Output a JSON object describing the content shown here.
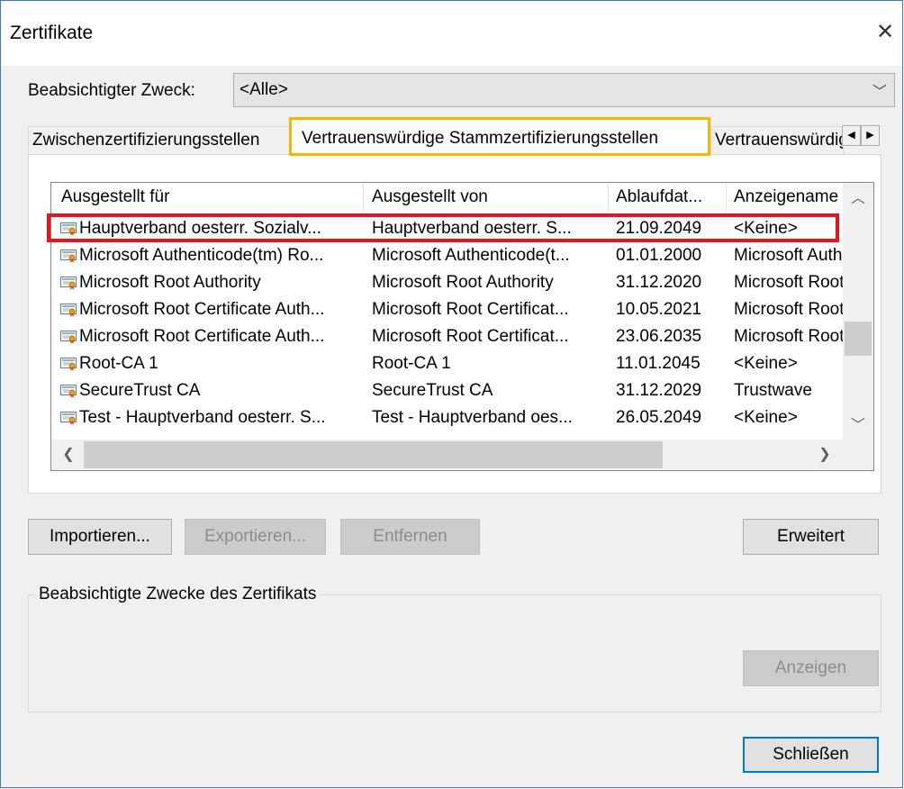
{
  "window": {
    "title": "Zertifikate"
  },
  "purpose": {
    "label": "Beabsichtigter Zweck:",
    "selected": "<Alle>"
  },
  "tabs": [
    {
      "label": "Zwischenzertifizierungsstellen"
    },
    {
      "label": "Vertrauenswürdige Stammzertifizierungsstellen"
    },
    {
      "label": "Vertrauenswürdige Herausgeber"
    }
  ],
  "table": {
    "columns": [
      "Ausgestellt für",
      "Ausgestellt von",
      "Ablaufdat...",
      "Anzeigename"
    ],
    "rows": [
      [
        "Hauptverband oesterr. Sozialv...",
        "Hauptverband oesterr. S...",
        "21.09.2049",
        "<Keine>"
      ],
      [
        "Microsoft Authenticode(tm) Ro...",
        "Microsoft Authenticode(t...",
        "01.01.2000",
        "Microsoft Authenticode"
      ],
      [
        "Microsoft Root Authority",
        "Microsoft Root Authority",
        "31.12.2020",
        "Microsoft Root"
      ],
      [
        "Microsoft Root Certificate Auth...",
        "Microsoft Root Certificat...",
        "10.05.2021",
        "Microsoft Root"
      ],
      [
        "Microsoft Root Certificate Auth...",
        "Microsoft Root Certificat...",
        "23.06.2035",
        "Microsoft Root"
      ],
      [
        "Root-CA 1",
        "Root-CA 1",
        "11.01.2045",
        "<Keine>"
      ],
      [
        "SecureTrust CA",
        "SecureTrust CA",
        "31.12.2029",
        "Trustwave"
      ],
      [
        "Test - Hauptverband oesterr. S...",
        "Test - Hauptverband oes...",
        "26.05.2049",
        "<Keine>"
      ]
    ]
  },
  "buttons": {
    "import": "Importieren...",
    "export": "Exportieren...",
    "remove": "Entfernen",
    "advanced": "Erweitert",
    "view": "Anzeigen",
    "close": "Schließen"
  },
  "purposes_group": {
    "title": "Beabsichtigte Zwecke des Zertifikats"
  },
  "colors": {
    "highlight_tab": "#f7b500",
    "highlight_row": "#e8141c",
    "accent": "#0078d7"
  }
}
